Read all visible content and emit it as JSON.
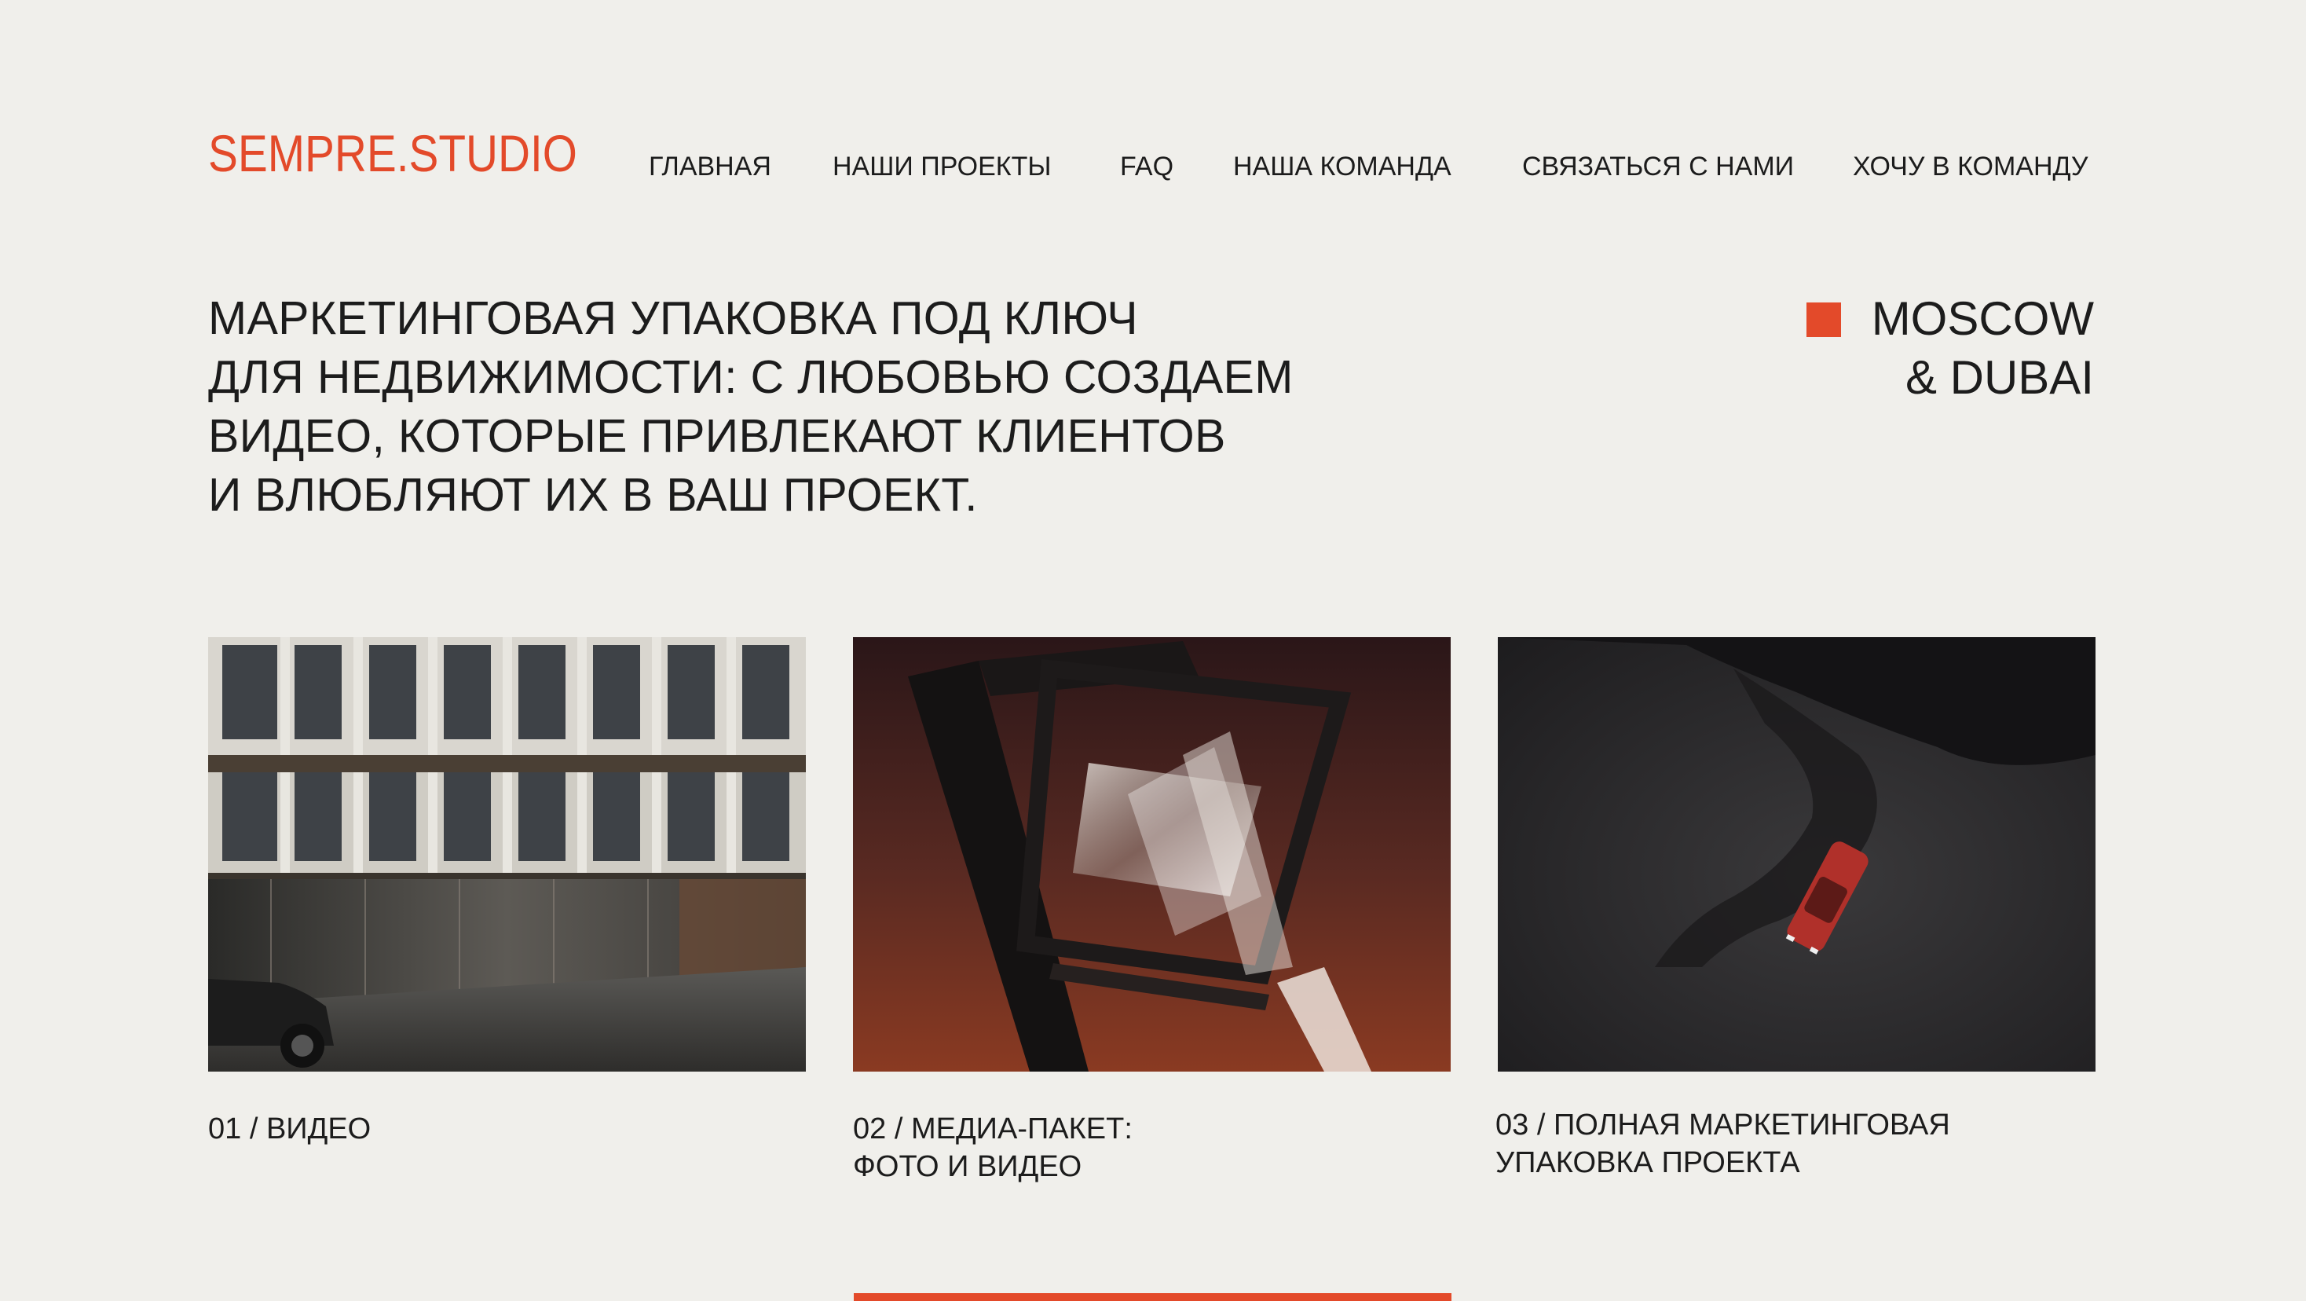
{
  "header": {
    "logo": "SEMPRE.STUDIO",
    "nav": [
      {
        "label": "ГЛАВНАЯ"
      },
      {
        "label": "НАШИ ПРОЕКТЫ"
      },
      {
        "label": "FAQ"
      },
      {
        "label": "НАША КОМАНДА"
      },
      {
        "label": "СВЯЗАТЬСЯ С НАМИ"
      },
      {
        "label": "ХОЧУ В КОМАНДУ"
      }
    ]
  },
  "hero": {
    "lines": [
      "МАРКЕТИНГОВАЯ УПАКОВКА ПОД КЛЮЧ",
      "ДЛЯ НЕДВИЖИМОСТИ: С ЛЮБОВЬЮ СОЗДАЕМ",
      "ВИДЕО, КОТОРЫЕ ПРИВЛЕКАЮТ КЛИЕНТОВ",
      "И ВЛЮБЛЯЮТ ИХ В ВАШ ПРОЕКТ."
    ]
  },
  "location": {
    "line1": "MOSCOW",
    "line2": "& DUBAI"
  },
  "services": [
    {
      "caption_line1": "01 / ВИДЕО",
      "caption_line2": ""
    },
    {
      "caption_line1": "02 / МЕДИА-ПАКЕТ:",
      "caption_line2": "ФОТО И ВИДЕО"
    },
    {
      "caption_line1": "03 / ПОЛНАЯ МАРКЕТИНГОВАЯ",
      "caption_line2": "УПАКОВКА ПРОЕКТА"
    }
  ],
  "colors": {
    "accent": "#e34a2a",
    "background": "#f0efeb",
    "text": "#1c1c1c"
  }
}
